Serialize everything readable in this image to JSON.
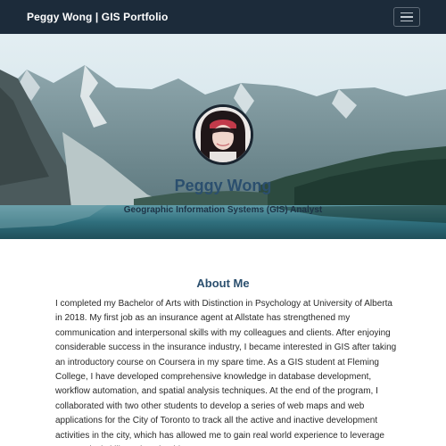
{
  "navbar": {
    "brand": "Peggy Wong | GIS Portfolio",
    "toggle_icon": "hamburger-menu-icon"
  },
  "hero": {
    "name": "Peggy Wong",
    "title": "Geographic Information Systems (GIS) Analyst"
  },
  "about": {
    "heading": "About Me",
    "text": "I completed my Bachelor of Arts with Distinction in Psychology at University of Alberta in 2018. My first job as an insurance agent at Allstate has strengthened my communication and interpersonal skills with my colleagues and clients. After enjoying considerable success in the insurance industry, I became interested in GIS after taking an introductory course on Coursera in my spare time. As a GIS student at Fleming College, I have developed comprehensive knowledge in database development, workflow automation, and spatial analysis techniques. At the end of the program, I collaborated with two other students to develop a series of web maps and web applications for the City of Toronto to track all the active and inactive development activities in the city, which has allowed me to gain real world experience to leverage my practical skills and work ethic."
  },
  "colors": {
    "navbar_bg": "#1c2b3a",
    "heading": "#2b4f6e"
  }
}
